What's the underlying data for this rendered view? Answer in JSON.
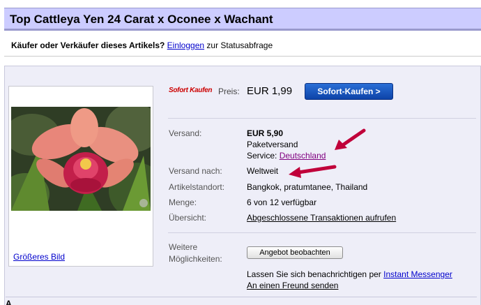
{
  "listing": {
    "title": "Top Cattleya Yen 24 Carat x Oconee x Wachant"
  },
  "status": {
    "question": "Käufer oder Verkäufer dieses Artikels?",
    "login_link": "Einloggen",
    "suffix": "zur Statusabfrage"
  },
  "image": {
    "bigger_link": "Größeres Bild"
  },
  "pricing": {
    "logo": "Sofort Kaufen",
    "price_label": "Preis:",
    "price_value": "EUR 1,99",
    "buy_button": "Sofort-Kaufen >"
  },
  "details": {
    "shipping_label": "Versand:",
    "shipping_cost": "EUR 5,90",
    "shipping_type": "Paketversand",
    "service_prefix": "Service:",
    "service_link": "Deutschland",
    "ships_to_label": "Versand nach:",
    "ships_to_value": "Weltweit",
    "location_label": "Artikelstandort:",
    "location_value": "Bangkok, pratumtanee, Thailand",
    "quantity_label": "Menge:",
    "quantity_value": "6 von 12 verfügbar",
    "overview_label": "Übersicht:",
    "overview_link": "Abgeschlossene Transaktionen aufrufen"
  },
  "options": {
    "label_line1": "Weitere",
    "label_line2": "Möglichkeiten:",
    "watch_button": "Angebot beobachten",
    "notify_prefix": "Lassen Sie sich benachrichtigen per",
    "notify_link": "Instant Messenger",
    "send_friend_link": "An einen Freund senden"
  },
  "footer": {
    "partial_heading": "A... ... ... ... ..."
  },
  "colors": {
    "title_bg": "#ccccff",
    "link": "#0000cc",
    "arrow": "#c0003a",
    "buy_button": "#0d43a8"
  }
}
